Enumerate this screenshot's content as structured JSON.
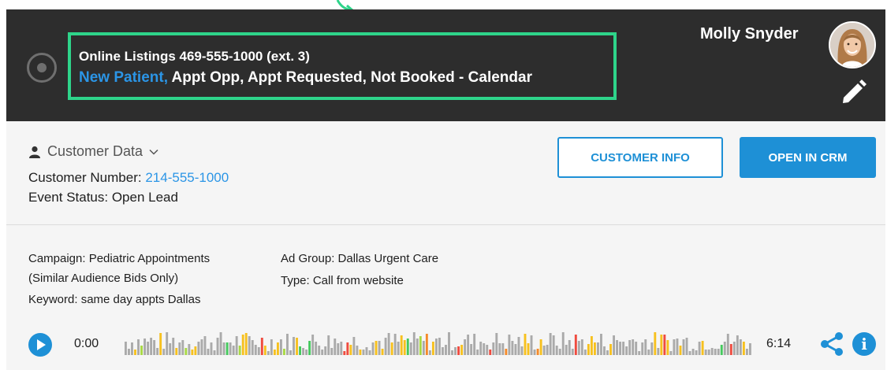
{
  "header": {
    "line1": "Online Listings 469-555-1000 (ext. 3)",
    "line2_highlight": "New Patient,",
    "line2_rest": " Appt Opp, Appt Requested, Not Booked - Calendar",
    "user_name": "Molly Snyder",
    "icons": {
      "status": "radio-button-icon",
      "edit": "pencil-icon",
      "annotation": "arrow-icon"
    }
  },
  "customer": {
    "section_title": "Customer Data",
    "number_label": "Customer Number:",
    "number_value": "214-555-1000",
    "event_status": "Event Status: Open Lead",
    "info_button": "CUSTOMER INFO",
    "crm_button": "OPEN IN CRM",
    "icons": {
      "person": "person-icon",
      "expand": "chevron-down-icon"
    }
  },
  "details": {
    "campaign_line1": "Campaign: Pediatric Appointments",
    "campaign_line2": "(Similar Audience Bids Only)",
    "keyword": "Keyword: same day appts Dallas",
    "ad_group": "Ad Group: Dallas Urgent Care",
    "type": "Type: Call from website"
  },
  "player": {
    "start_time": "0:00",
    "end_time": "6:14",
    "info_glyph": "i",
    "icons": {
      "play": "play-icon",
      "share": "share-icon",
      "info": "info-icon"
    }
  },
  "colors": {
    "accent": "#1e90d6",
    "link": "#2b95e6",
    "highlight_box": "#2ed48a",
    "header_bg": "#2d2d2d",
    "wave_gray": "#aaaaaa",
    "wave_yellow": "#f7c11e",
    "wave_green": "#45c95e",
    "wave_red": "#ef4b3f",
    "wave_orange": "#f58a2a",
    "wave_lime": "#a8d944"
  }
}
